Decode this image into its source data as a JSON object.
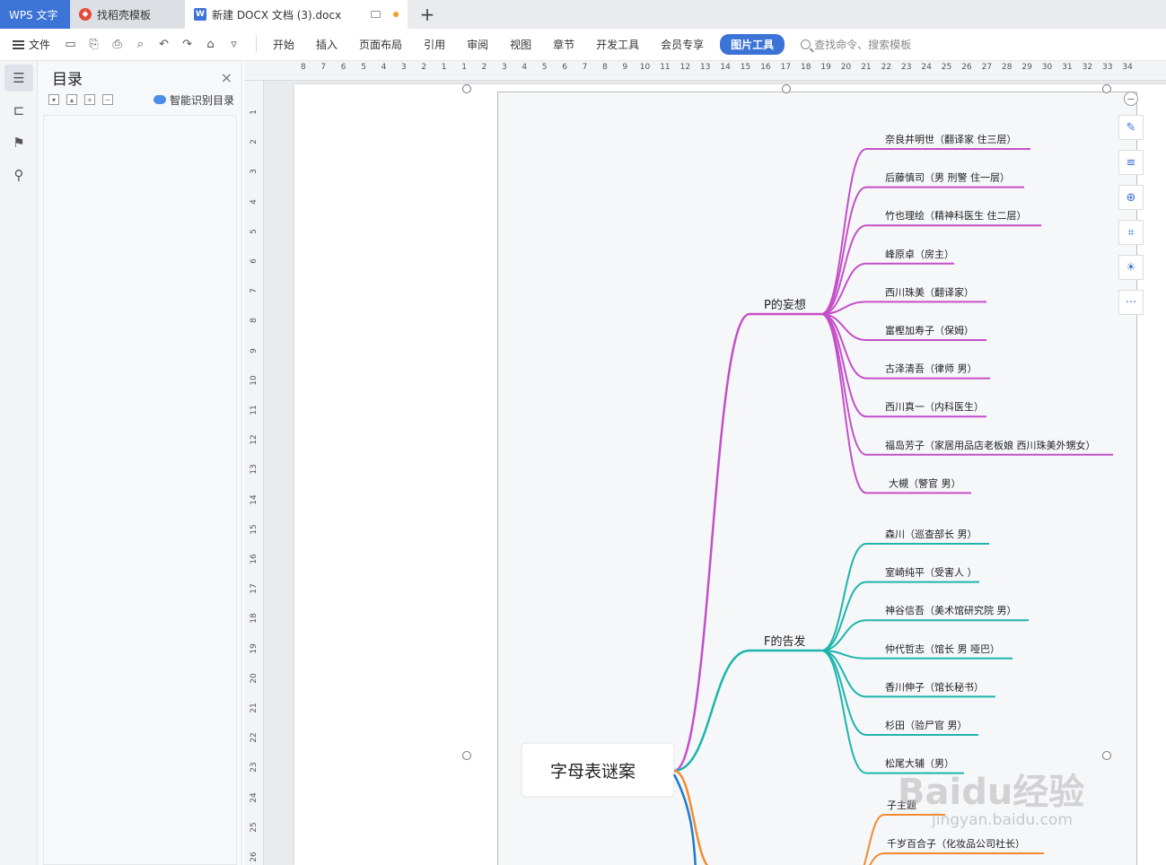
{
  "titlebar": {
    "tabs": [
      {
        "label": "WPS 文字"
      },
      {
        "label": "找稻壳模板"
      },
      {
        "label": "新建 DOCX 文档 (3).docx"
      }
    ],
    "add_tab": "+"
  },
  "toolbar": {
    "file_label": "文件",
    "menu": [
      "开始",
      "插入",
      "页面布局",
      "引用",
      "审阅",
      "视图",
      "章节",
      "开发工具",
      "会员专享"
    ],
    "active_tab": "图片工具",
    "search_placeholder": "查找命令、搜索模板"
  },
  "toc": {
    "title": "目录",
    "close": "×",
    "smart_label": "智能识别目录"
  },
  "rulers": {
    "horizontal": [
      "8",
      "7",
      "6",
      "5",
      "4",
      "3",
      "2",
      "1",
      "1",
      "2",
      "3",
      "4",
      "5",
      "6",
      "7",
      "8",
      "9",
      "10",
      "11",
      "12",
      "13",
      "14",
      "15",
      "16",
      "17",
      "18",
      "19",
      "20",
      "21",
      "22",
      "23",
      "24",
      "25",
      "26",
      "27",
      "28",
      "29",
      "30",
      "31",
      "32",
      "33",
      "34"
    ],
    "vertical": [
      "1",
      "2",
      "3",
      "4",
      "5",
      "6",
      "7",
      "8",
      "9",
      "10",
      "11",
      "12",
      "13",
      "14",
      "15",
      "16",
      "17",
      "18",
      "19",
      "20",
      "21",
      "22",
      "23",
      "24",
      "25",
      "26"
    ]
  },
  "mindmap": {
    "root": "字母表谜案",
    "colors": {
      "p": "#c34fc9",
      "f": "#1db5ad",
      "orange": "#f28b30",
      "blue": "#1b7bd1"
    },
    "branches": [
      {
        "label": "P的妄想",
        "children": [
          "奈良井明世（翻译家 住三层）",
          "后藤慎司（男 刑警 住一层）",
          "竹也理绘（精神科医生 住二层）",
          "峰原卓（房主）",
          "西川珠美（翻译家）",
          "富樫加寿子（保姆）",
          "古泽清吾（律师 男）",
          "西川真一（内科医生）",
          "福岛芳子（家居用品店老板娘 西川珠美外甥女）",
          "大槻（警官 男）"
        ]
      },
      {
        "label": "F的告发",
        "children": [
          "森川（巡查部长 男）",
          "室崎纯平（受害人 ）",
          "神谷信吾（美术馆研究院 男）",
          "仲代哲志（馆长 男 哑巴）",
          "香川伸子（馆长秘书）",
          "杉田（验尸官 男）",
          "松尾大辅（男）"
        ]
      },
      {
        "label": "",
        "children": [
          "子主题",
          "千岁百合子（化妆品公司社长）"
        ]
      }
    ]
  },
  "watermark": {
    "main": "Baidu经验",
    "sub": "jingyan.baidu.com"
  }
}
